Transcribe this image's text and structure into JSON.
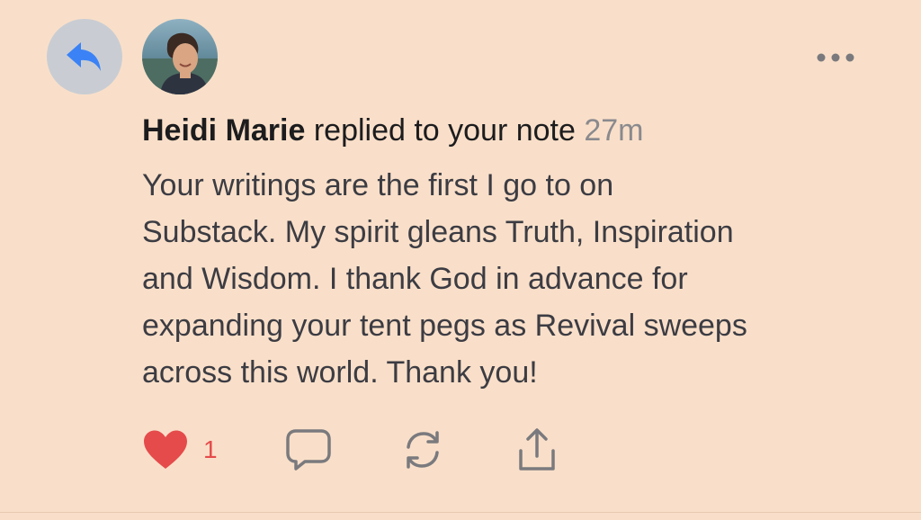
{
  "notification": {
    "author": "Heidi Marie",
    "action": " replied to your note ",
    "timestamp": "27m",
    "body": "Your writings are the first I go to on\nSubstack.  My spirit gleans Truth, Inspiration\nand Wisdom.  I thank God in advance for\nexpanding your tent pegs as Revival sweeps\nacross this world.  Thank you!"
  },
  "actions": {
    "like_count": "1"
  },
  "icons": {
    "reply_badge": "reply-arrow-icon",
    "more": "more-dots-icon",
    "like": "heart-icon",
    "comment": "comment-bubble-icon",
    "restack": "restack-arrows-icon",
    "share": "share-upload-icon"
  },
  "colors": {
    "background": "#f9dfc9",
    "reply_badge_bg": "#c9cdd3",
    "reply_arrow": "#3b82f6",
    "like": "#e54b4b",
    "icon_gray": "#7a7a7e",
    "timestamp": "#8a8a8e"
  }
}
